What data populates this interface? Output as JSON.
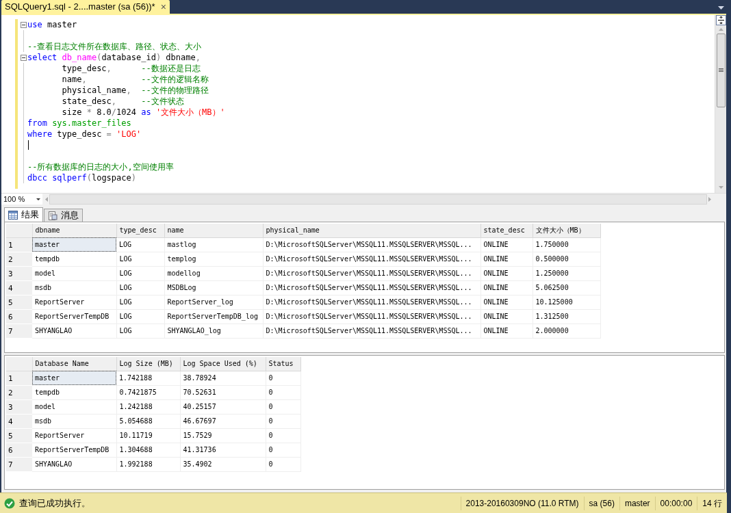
{
  "document_tab": {
    "title": "SQLQuery1.sql - 2....master (sa (56))*",
    "close": "×"
  },
  "editor": {
    "lines": [
      {
        "kind": "code",
        "collapsible": true,
        "tokens": [
          {
            "kind": "keyword",
            "text": "use"
          },
          {
            "kind": "plain",
            "text": " master"
          }
        ]
      },
      {
        "kind": "blank",
        "collapsible": false
      },
      {
        "kind": "code",
        "collapsible": false,
        "tokens": [
          {
            "kind": "comment",
            "text": "--查看日志文件所在数据库、路径、状态、大小"
          }
        ]
      },
      {
        "kind": "code",
        "collapsible": true,
        "tokens": [
          {
            "kind": "keyword",
            "text": "select"
          },
          {
            "kind": "function",
            "text": " db_name"
          },
          {
            "kind": "operator",
            "text": "("
          },
          {
            "kind": "plain",
            "text": "database_id"
          },
          {
            "kind": "operator",
            "text": ")"
          },
          {
            "kind": "plain",
            "text": " dbname"
          },
          {
            "kind": "operator",
            "text": ","
          }
        ]
      },
      {
        "kind": "code",
        "collapsible": false,
        "tokens": [
          {
            "kind": "plain",
            "text": "       type_desc"
          },
          {
            "kind": "operator",
            "text": ","
          },
          {
            "kind": "comment",
            "text": "      --数据还是日志"
          }
        ]
      },
      {
        "kind": "code",
        "collapsible": false,
        "tokens": [
          {
            "kind": "plain",
            "text": "       name"
          },
          {
            "kind": "operator",
            "text": ","
          },
          {
            "kind": "comment",
            "text": "           --文件的逻辑名称"
          }
        ]
      },
      {
        "kind": "code",
        "collapsible": false,
        "tokens": [
          {
            "kind": "plain",
            "text": "       physical_name"
          },
          {
            "kind": "operator",
            "text": ","
          },
          {
            "kind": "comment",
            "text": "  --文件的物理路径"
          }
        ]
      },
      {
        "kind": "code",
        "collapsible": false,
        "tokens": [
          {
            "kind": "plain",
            "text": "       state_desc"
          },
          {
            "kind": "operator",
            "text": ","
          },
          {
            "kind": "comment",
            "text": "     --文件状态"
          }
        ]
      },
      {
        "kind": "code",
        "collapsible": false,
        "tokens": [
          {
            "kind": "plain",
            "text": "       size "
          },
          {
            "kind": "operator",
            "text": "*"
          },
          {
            "kind": "plain",
            "text": " 8.0"
          },
          {
            "kind": "operator",
            "text": "/"
          },
          {
            "kind": "plain",
            "text": "1024 "
          },
          {
            "kind": "keyword",
            "text": "as"
          },
          {
            "kind": "string",
            "text": " '文件大小（MB）'"
          }
        ]
      },
      {
        "kind": "code",
        "collapsible": false,
        "tokens": [
          {
            "kind": "keyword",
            "text": "from"
          },
          {
            "kind": "system",
            "text": " sys.master_files"
          }
        ]
      },
      {
        "kind": "code",
        "collapsible": false,
        "tokens": [
          {
            "kind": "keyword",
            "text": "where"
          },
          {
            "kind": "plain",
            "text": " type_desc "
          },
          {
            "kind": "operator",
            "text": "="
          },
          {
            "kind": "string",
            "text": " 'LOG'"
          }
        ]
      },
      {
        "kind": "cursor",
        "collapsible": false
      },
      {
        "kind": "blank",
        "collapsible": false
      },
      {
        "kind": "code",
        "collapsible": false,
        "tokens": [
          {
            "kind": "comment",
            "text": "--所有数据库的日志的大小,空间使用率"
          }
        ]
      },
      {
        "kind": "code",
        "collapsible": false,
        "tokens": [
          {
            "kind": "keyword",
            "text": "dbcc"
          },
          {
            "kind": "keyword",
            "text": " sqlperf"
          },
          {
            "kind": "operator",
            "text": "("
          },
          {
            "kind": "plain",
            "text": "logspace"
          },
          {
            "kind": "operator",
            "text": ")"
          }
        ]
      }
    ]
  },
  "zoom": {
    "value": "100 %"
  },
  "result_tabs": [
    {
      "label": "结果",
      "kind": "grid",
      "selected": true
    },
    {
      "label": "消息",
      "kind": "messages",
      "selected": false
    }
  ],
  "grids": [
    {
      "columns": [
        "dbname",
        "type_desc",
        "name",
        "physical_name",
        "state_desc",
        "文件大小（MB）"
      ],
      "rows": [
        {
          "number": "1",
          "selected": true,
          "cells": [
            "master",
            "LOG",
            "mastlog",
            "D:\\MicrosoftSQLServer\\MSSQL11.MSSQLSERVER\\MSSQL...",
            "ONLINE",
            "1.750000"
          ]
        },
        {
          "number": "2",
          "selected": false,
          "cells": [
            "tempdb",
            "LOG",
            "templog",
            "D:\\MicrosoftSQLServer\\MSSQL11.MSSQLSERVER\\MSSQL...",
            "ONLINE",
            "0.500000"
          ]
        },
        {
          "number": "3",
          "selected": false,
          "cells": [
            "model",
            "LOG",
            "modellog",
            "D:\\MicrosoftSQLServer\\MSSQL11.MSSQLSERVER\\MSSQL...",
            "ONLINE",
            "1.250000"
          ]
        },
        {
          "number": "4",
          "selected": false,
          "cells": [
            "msdb",
            "LOG",
            "MSDBLog",
            "D:\\MicrosoftSQLServer\\MSSQL11.MSSQLSERVER\\MSSQL...",
            "ONLINE",
            "5.062500"
          ]
        },
        {
          "number": "5",
          "selected": false,
          "cells": [
            "ReportServer",
            "LOG",
            "ReportServer_log",
            "D:\\MicrosoftSQLServer\\MSSQL11.MSSQLSERVER\\MSSQL...",
            "ONLINE",
            "10.125000"
          ]
        },
        {
          "number": "6",
          "selected": false,
          "cells": [
            "ReportServerTempDB",
            "LOG",
            "ReportServerTempDB_log",
            "D:\\MicrosoftSQLServer\\MSSQL11.MSSQLSERVER\\MSSQL...",
            "ONLINE",
            "1.312500"
          ]
        },
        {
          "number": "7",
          "selected": false,
          "cells": [
            "SHYANGLAO",
            "LOG",
            "SHYANGLAO_log",
            "D:\\MicrosoftSQLServer\\MSSQL11.MSSQLSERVER\\MSSQL...",
            "ONLINE",
            "2.000000"
          ]
        }
      ]
    },
    {
      "columns": [
        "Database Name",
        "Log Size (MB)",
        "Log Space Used (%)",
        "Status"
      ],
      "rows": [
        {
          "number": "1",
          "selected": true,
          "cells": [
            "master",
            "1.742188",
            "38.78924",
            "0"
          ]
        },
        {
          "number": "2",
          "selected": false,
          "cells": [
            "tempdb",
            "0.7421875",
            "70.52631",
            "0"
          ]
        },
        {
          "number": "3",
          "selected": false,
          "cells": [
            "model",
            "1.242188",
            "40.25157",
            "0"
          ]
        },
        {
          "number": "4",
          "selected": false,
          "cells": [
            "msdb",
            "5.054688",
            "46.67697",
            "0"
          ]
        },
        {
          "number": "5",
          "selected": false,
          "cells": [
            "ReportServer",
            "10.11719",
            "15.7529",
            "0"
          ]
        },
        {
          "number": "6",
          "selected": false,
          "cells": [
            "ReportServerTempDB",
            "1.304688",
            "41.31736",
            "0"
          ]
        },
        {
          "number": "7",
          "selected": false,
          "cells": [
            "SHYANGLAO",
            "1.992188",
            "35.4902",
            "0"
          ]
        }
      ]
    }
  ],
  "status_bar": {
    "message": "查询已成功执行。",
    "segments": [
      "2013-20160309NO (11.0 RTM)",
      "sa (56)",
      "master",
      "00:00:00",
      "14 行"
    ]
  }
}
